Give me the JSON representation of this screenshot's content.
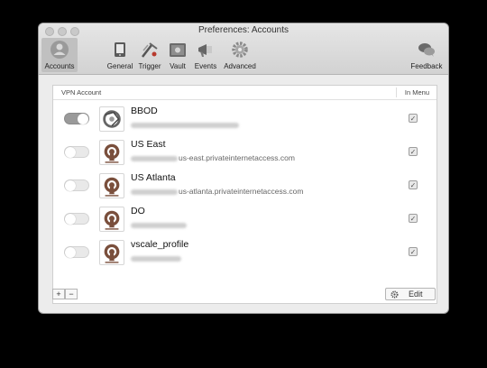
{
  "window": {
    "title": "Preferences: Accounts"
  },
  "toolbar": {
    "accounts": "Accounts",
    "general": "General",
    "trigger": "Trigger",
    "vault": "Vault",
    "events": "Events",
    "advanced": "Advanced",
    "feedback": "Feedback"
  },
  "table": {
    "col_account": "VPN Account",
    "col_menu": "In Menu"
  },
  "rows": [
    {
      "name": "BBOD",
      "host_visible": "",
      "enabled": true,
      "in_menu": true
    },
    {
      "name": "US East",
      "host_visible": "us-east.privateinternetaccess.com",
      "enabled": false,
      "in_menu": true
    },
    {
      "name": "US Atlanta",
      "host_visible": "us-atlanta.privateinternetaccess.com",
      "enabled": false,
      "in_menu": true
    },
    {
      "name": "DO",
      "host_visible": "",
      "enabled": false,
      "in_menu": true
    },
    {
      "name": "vscale_profile",
      "host_visible": "",
      "enabled": false,
      "in_menu": true
    }
  ],
  "footer": {
    "add_label": "+",
    "remove_label": "−",
    "edit_label": "Edit"
  },
  "colors": {
    "openvpn_brown": "#7a4f3c",
    "toggle_on": "#9a9a9a"
  }
}
